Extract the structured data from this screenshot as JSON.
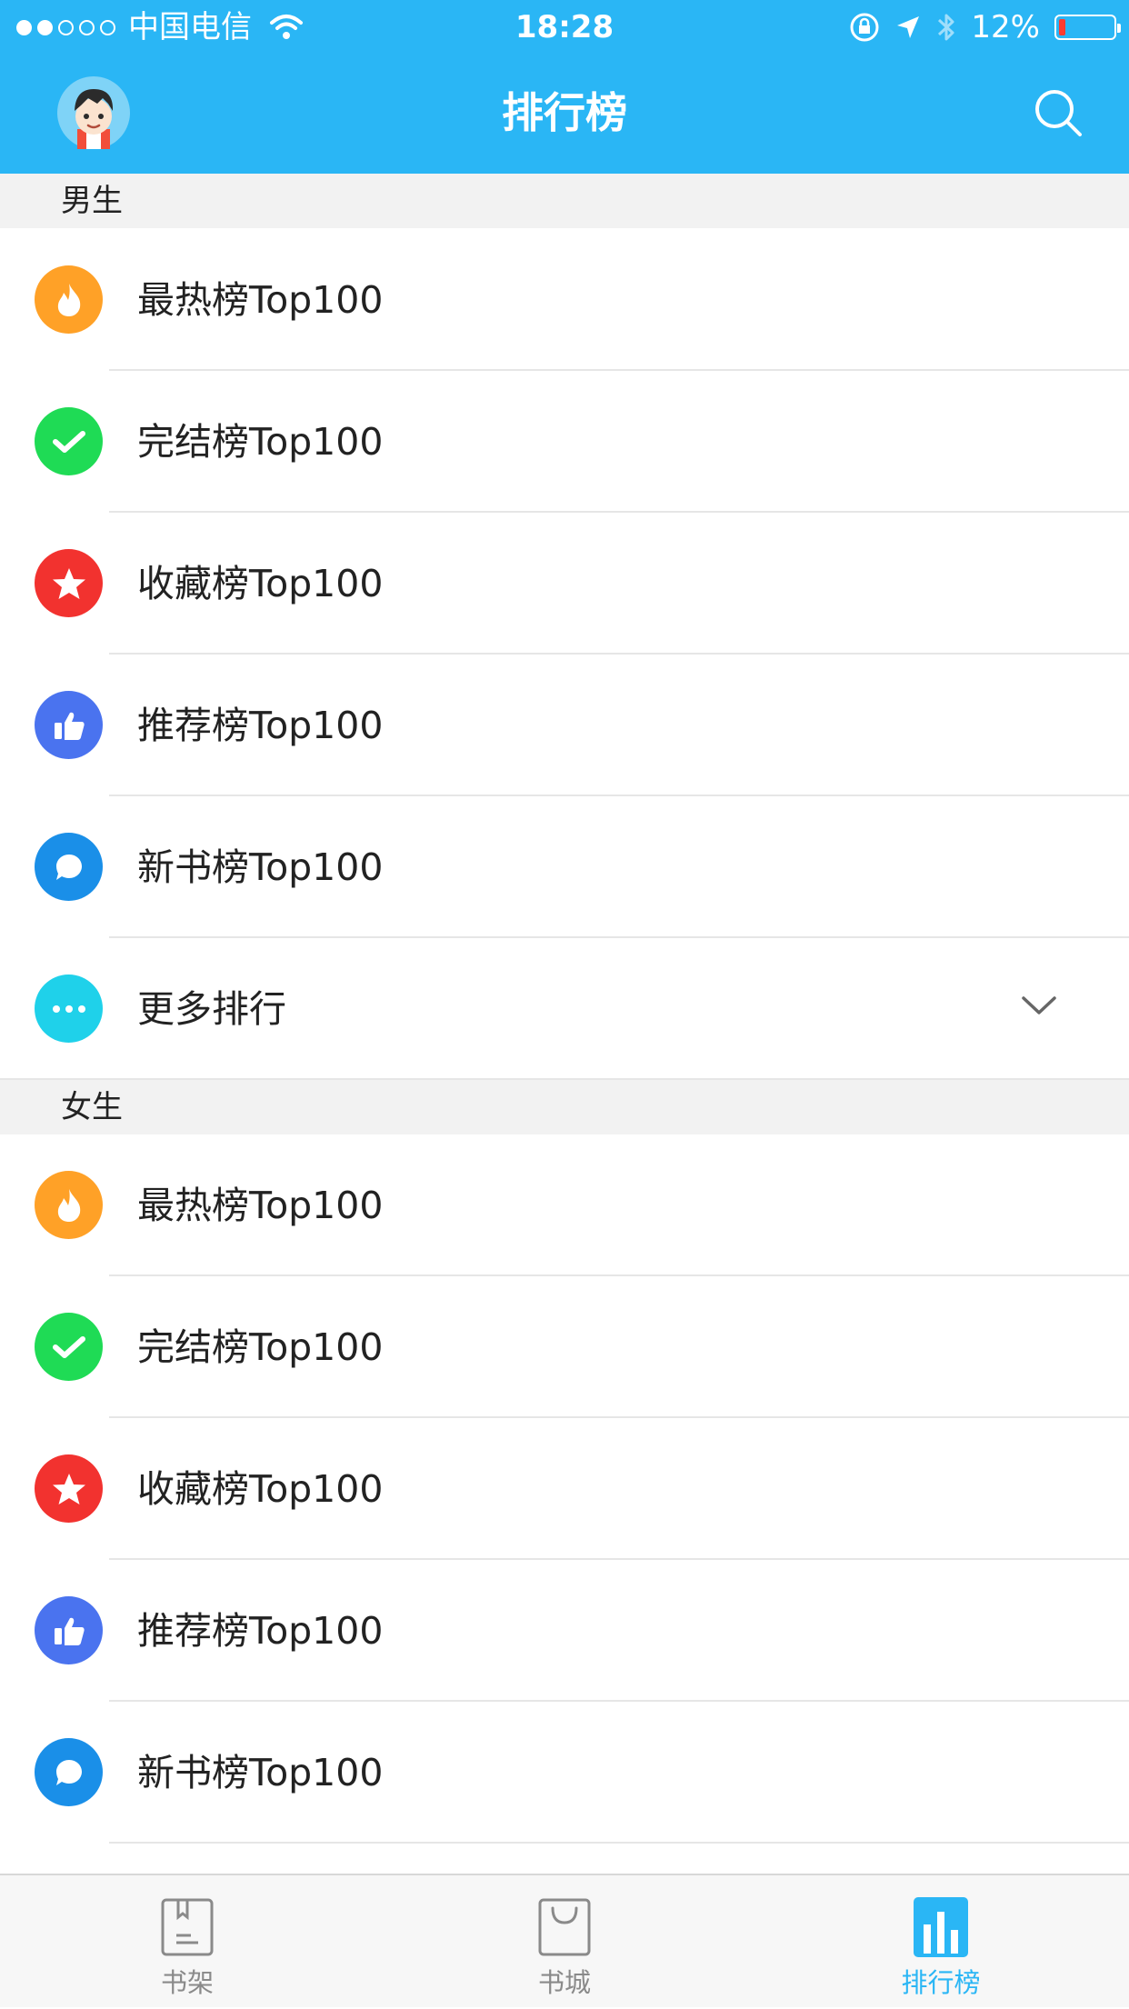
{
  "status_bar": {
    "carrier": "中国电信",
    "time": "18:28",
    "battery": "12%",
    "battery_level": 0.12,
    "signal_bars": 2
  },
  "nav": {
    "title": "排行榜"
  },
  "sections": [
    {
      "header": "男生",
      "items": [
        {
          "label": "最热榜Top100",
          "icon": "flame-icon",
          "color": "#ffa127"
        },
        {
          "label": "完结榜Top100",
          "icon": "check-icon",
          "color": "#1fdb55"
        },
        {
          "label": "收藏榜Top100",
          "icon": "star-icon",
          "color": "#f2322f"
        },
        {
          "label": "推荐榜Top100",
          "icon": "thumbs-up-icon",
          "color": "#4a73ef"
        },
        {
          "label": "新书榜Top100",
          "icon": "chat-bubble-icon",
          "color": "#1a8fe8"
        },
        {
          "label": "更多排行",
          "icon": "more-dots-icon",
          "color": "#1fd1ea"
        }
      ]
    },
    {
      "header": "女生",
      "items": [
        {
          "label": "最热榜Top100",
          "icon": "flame-icon",
          "color": "#ffa127"
        },
        {
          "label": "完结榜Top100",
          "icon": "check-icon",
          "color": "#1fdb55"
        },
        {
          "label": "收藏榜Top100",
          "icon": "star-icon",
          "color": "#f2322f"
        },
        {
          "label": "推荐榜Top100",
          "icon": "thumbs-up-icon",
          "color": "#4a73ef"
        },
        {
          "label": "新书榜Top100",
          "icon": "chat-bubble-icon",
          "color": "#1a8fe8"
        }
      ]
    }
  ],
  "tabbar": {
    "tabs": [
      {
        "label": "书架",
        "icon": "bookshelf-icon"
      },
      {
        "label": "书城",
        "icon": "bookstore-bag-icon"
      },
      {
        "label": "排行榜",
        "icon": "ranking-chart-icon",
        "active": true
      }
    ]
  },
  "colors": {
    "brand": "#2ab6f5",
    "section_bg": "#f2f2f2",
    "tab_inactive": "#8a8a8a"
  }
}
